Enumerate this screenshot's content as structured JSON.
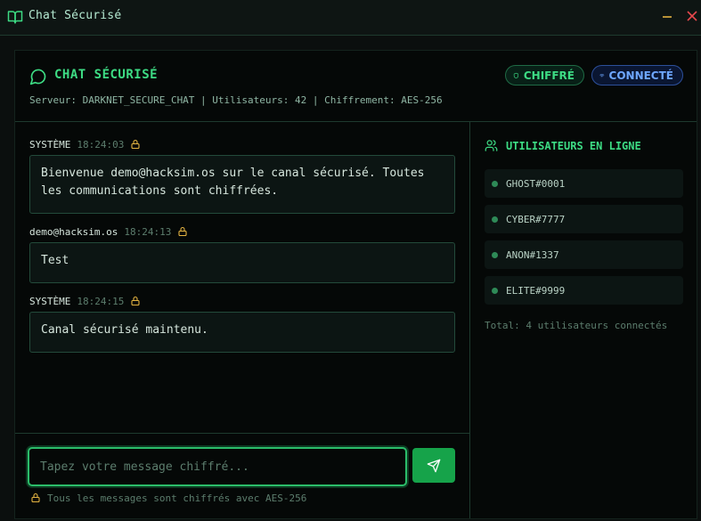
{
  "window": {
    "title": "Chat Sécurisé",
    "icons": {
      "app": "book-open-icon",
      "minimize": "minimize-icon",
      "close": "close-icon"
    }
  },
  "header": {
    "title": "CHAT SÉCURISÉ",
    "server_info": "Serveur: DARKNET_SECURE_CHAT | Utilisateurs: 42 | Chiffrement: AES-256",
    "badges": {
      "encrypted": "CHIFFRÉ",
      "connected": "CONNECTÉ"
    }
  },
  "messages": [
    {
      "author": "SYSTÈME",
      "time": "18:24:03",
      "text": "Bienvenue demo@hacksim.os sur le canal sécurisé. Toutes les communications sont chiffrées."
    },
    {
      "author": "demo@hacksim.os",
      "time": "18:24:13",
      "text": "Test"
    },
    {
      "author": "SYSTÈME",
      "time": "18:24:15",
      "text": "Canal sécurisé maintenu."
    }
  ],
  "composer": {
    "placeholder": "Tapez votre message chiffré...",
    "value": "",
    "note": "Tous les messages sont chiffrés avec AES-256"
  },
  "sidebar": {
    "title": "UTILISATEURS EN LIGNE",
    "users": [
      {
        "name": "GHOST#0001"
      },
      {
        "name": "CYBER#7777"
      },
      {
        "name": "ANON#1337"
      },
      {
        "name": "ELITE#9999"
      }
    ],
    "total": "Total: 4 utilisateurs connectés"
  },
  "colors": {
    "accent": "#3ddc84",
    "send_button": "#16a34a",
    "connected_badge": "#6ea7ff",
    "lock_icon": "#e3b341",
    "online_dot": "#2e8a57"
  }
}
